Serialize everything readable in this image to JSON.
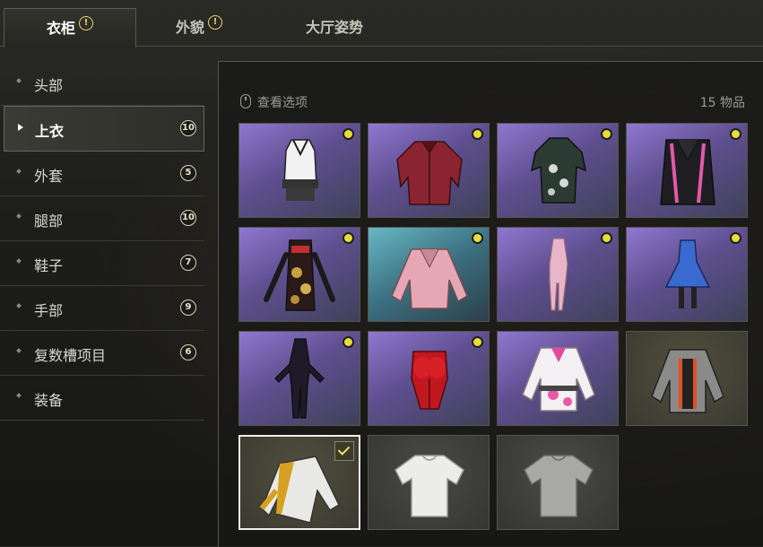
{
  "tabs": [
    {
      "label": "衣柜",
      "alert": "!",
      "active": true
    },
    {
      "label": "外貌",
      "alert": "!",
      "active": false
    },
    {
      "label": "大厅姿势",
      "active": false
    }
  ],
  "sidebar": {
    "items": [
      {
        "label": "头部"
      },
      {
        "label": "上衣",
        "count": "10",
        "active": true
      },
      {
        "label": "外套",
        "count": "5"
      },
      {
        "label": "腿部",
        "count": "10"
      },
      {
        "label": "鞋子",
        "count": "7"
      },
      {
        "label": "手部",
        "count": "9"
      },
      {
        "label": "复数槽项目",
        "count": "6"
      },
      {
        "label": "装备"
      }
    ]
  },
  "panel": {
    "view_options_label": "查看选项",
    "item_count": "15 物品"
  },
  "items": [
    {
      "icon": "white-vest-top-icon",
      "bg": "purple",
      "new": true
    },
    {
      "icon": "red-plaid-shirt-icon",
      "bg": "purple",
      "new": true
    },
    {
      "icon": "floral-qipao-dress-icon",
      "bg": "purple",
      "new": true
    },
    {
      "icon": "black-pink-vest-icon",
      "bg": "purple",
      "new": true
    },
    {
      "icon": "floral-gloved-dress-icon",
      "bg": "purple",
      "new": true
    },
    {
      "icon": "pink-leather-jacket-icon",
      "bg": "teal",
      "new": true
    },
    {
      "icon": "pink-bodysuit-icon",
      "bg": "purple",
      "new": true
    },
    {
      "icon": "blue-dress-icon",
      "bg": "purple",
      "new": true
    },
    {
      "icon": "black-bodysuit-icon",
      "bg": "purple",
      "new": true
    },
    {
      "icon": "red-corset-icon",
      "bg": "purple",
      "new": true
    },
    {
      "icon": "white-pink-jacket-icon",
      "bg": "purple",
      "new": false
    },
    {
      "icon": "gray-orange-jacket-icon",
      "bg": "olive",
      "new": false
    },
    {
      "icon": "gold-white-jacket-icon",
      "bg": "olive",
      "new": false,
      "equipped": true
    },
    {
      "icon": "white-tshirt-icon",
      "bg": "gray",
      "new": false
    },
    {
      "icon": "gray-tshirt-icon",
      "bg": "gray",
      "new": false
    }
  ],
  "colors": {
    "accent": "#e6dc3c",
    "rare_bg": "#8f77d0",
    "panel_bg": "#1d1d1a"
  }
}
